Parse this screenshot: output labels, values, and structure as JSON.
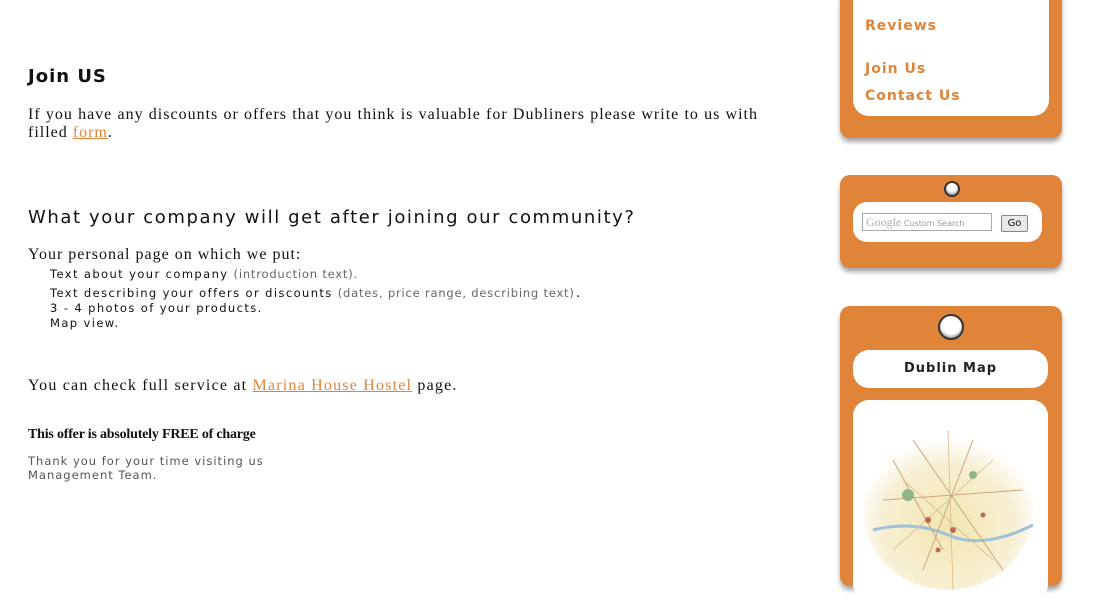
{
  "main": {
    "join_heading": "Join US",
    "intro_text": "If you have any discounts or offers that you think is valuable for Dubliners please write to us with filled ",
    "intro_link": "form",
    "intro_end": ".",
    "community_heading": "What your company will get after joining our community?",
    "personal_page": "Your personal page on which we put:",
    "features": [
      {
        "text": "Text about your company ",
        "paren": "(introduction text)."
      },
      {
        "text": "Text describing your offers or discounts ",
        "paren": "(dates, price range, describing text)",
        "end": "."
      },
      {
        "text": "3 - 4 photos of your products."
      },
      {
        "text": "Map view."
      }
    ],
    "check_text": "You can check full service at ",
    "check_link": "Marina House Hostel",
    "check_end": " page.",
    "free_text": "This offer is absolutely FREE of charge",
    "thanks_line1": "Thank you for your time visiting us",
    "thanks_line2": "Management Team."
  },
  "sidebar": {
    "nav": [
      "Reviews",
      "Join Us",
      "Contact Us"
    ],
    "search": {
      "logo": "Google",
      "placeholder": "Custom Search",
      "go_label": "Go"
    },
    "map_title": "Dublin Map"
  },
  "colors": {
    "accent": "#e0843a",
    "link": "#e0843a",
    "text": "#111111",
    "muted": "#555555"
  }
}
